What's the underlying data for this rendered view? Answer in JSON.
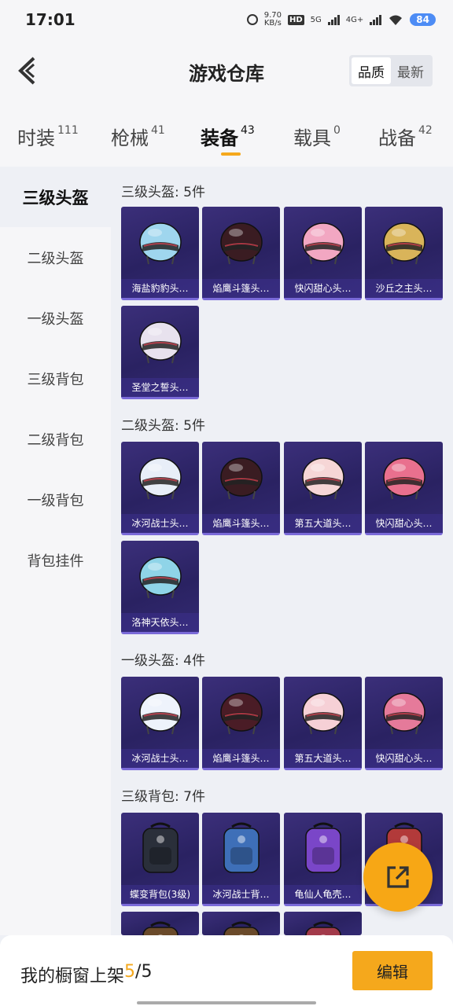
{
  "status_bar": {
    "time": "17:01",
    "net_speed": "9.70",
    "net_unit": "KB/s",
    "hd": "HD",
    "net_type_1": "5G",
    "net_type_2": "4G+",
    "battery": "84"
  },
  "header": {
    "title": "游戏仓库",
    "sort_options": [
      "品质",
      "最新"
    ],
    "sort_selected": "品质"
  },
  "tabs": [
    {
      "label": "时装",
      "count": "111"
    },
    {
      "label": "枪械",
      "count": "41"
    },
    {
      "label": "装备",
      "count": "43"
    },
    {
      "label": "载具",
      "count": "0"
    },
    {
      "label": "战备",
      "count": "42"
    }
  ],
  "active_tab": "装备",
  "sidebar": {
    "items": [
      "三级头盔",
      "二级头盔",
      "一级头盔",
      "三级背包",
      "二级背包",
      "一级背包",
      "背包挂件"
    ],
    "active": "三级头盔"
  },
  "sections": [
    {
      "title": "三级头盔: 5件",
      "items": [
        {
          "name": "海盐豹豹头…",
          "icon": "helmet-icon",
          "color": "#9fd6ee"
        },
        {
          "name": "焰鹰斗篷头…",
          "icon": "helmet-icon",
          "color": "#3a1c22"
        },
        {
          "name": "快闪甜心头…",
          "icon": "helmet-icon",
          "color": "#f2a7c2"
        },
        {
          "name": "沙丘之主头…",
          "icon": "helmet-icon",
          "color": "#d9b45a"
        },
        {
          "name": "圣堂之誓头…",
          "icon": "helmet-icon",
          "color": "#e8e2ee"
        }
      ]
    },
    {
      "title": "二级头盔: 5件",
      "items": [
        {
          "name": "冰河战士头…",
          "icon": "helmet-icon",
          "color": "#e8eef8"
        },
        {
          "name": "焰鹰斗篷头…",
          "icon": "helmet-icon",
          "color": "#3a1c22"
        },
        {
          "name": "第五大道头…",
          "icon": "helmet-icon",
          "color": "#f6d6d6"
        },
        {
          "name": "快闪甜心头…",
          "icon": "helmet-icon",
          "color": "#e9708e"
        },
        {
          "name": "洛神天依头…",
          "icon": "helmet-icon",
          "color": "#8fd4e8"
        }
      ]
    },
    {
      "title": "一级头盔: 4件",
      "items": [
        {
          "name": "冰河战士头…",
          "icon": "helmet-icon",
          "color": "#eef3fb"
        },
        {
          "name": "焰鹰斗篷头…",
          "icon": "helmet-icon",
          "color": "#4a1c26"
        },
        {
          "name": "第五大道头…",
          "icon": "helmet-icon",
          "color": "#f6d0d6"
        },
        {
          "name": "快闪甜心头…",
          "icon": "helmet-icon",
          "color": "#e57a9a"
        }
      ]
    },
    {
      "title": "三级背包: 7件",
      "items": [
        {
          "name": "蝶变背包(3级)",
          "icon": "backpack-icon",
          "color": "#2a2f3a"
        },
        {
          "name": "冰河战士背…",
          "icon": "backpack-icon",
          "color": "#3e6fb8"
        },
        {
          "name": "龟仙人龟壳…",
          "icon": "backpack-icon",
          "color": "#7a46c8"
        },
        {
          "name": "",
          "icon": "backpack-icon",
          "color": "#b23a3a"
        },
        {
          "name": "",
          "icon": "backpack-icon",
          "color": "#6a4a2a"
        },
        {
          "name": "",
          "icon": "backpack-icon",
          "color": "#6a4a2a"
        },
        {
          "name": "",
          "icon": "backpack-icon",
          "color": "#a23a4a"
        }
      ]
    }
  ],
  "bottom_bar": {
    "label": "我的橱窗上架",
    "current": "5",
    "separator": "/",
    "total": "5",
    "edit_label": "编辑"
  },
  "colors": {
    "accent": "#f5a81c",
    "card_bg": "#2e2568",
    "card_border": "#7a6ad8"
  }
}
